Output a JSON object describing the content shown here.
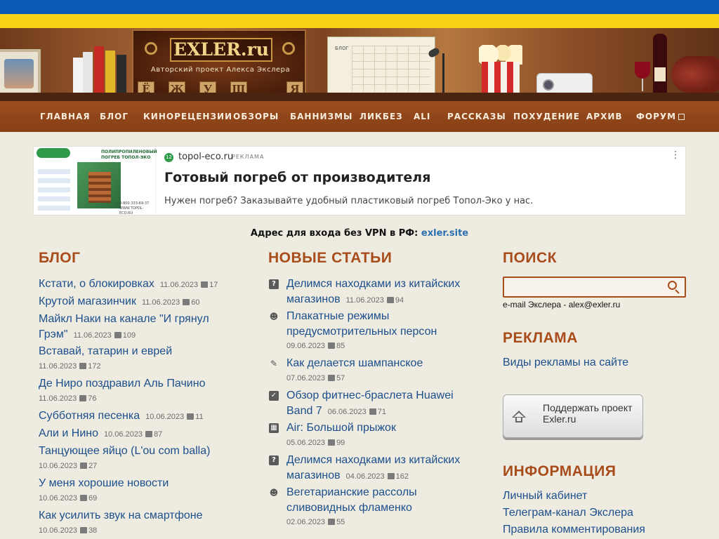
{
  "site": {
    "logo_text": "EXLER.ru",
    "logo_subtitle": "Авторский проект Алекса Экслера",
    "calendar_label": "БЛОГ",
    "banner_letters": [
      "Ё",
      "Ж",
      "У",
      "Щ",
      "Я"
    ]
  },
  "nav": {
    "items": [
      "ГЛАВНАЯ",
      "БЛОГ",
      "КИНОРЕЦЕНЗИИ",
      "ОБЗОРЫ",
      "БАННИЗМЫ",
      "ЛИКБЕЗ",
      "ALI",
      "РАССКАЗЫ",
      "ПОХУДЕНИЕ",
      "АРХИВ",
      "ФОРУМ"
    ]
  },
  "ad": {
    "source": "topol-eco.ru",
    "tag": "РЕКЛАМА",
    "title": "Готовый погреб от производителя",
    "description": "Нужен погреб? Заказывайте удобный пластиковый погреб Топол-Эко у нас.",
    "image_brand": "ТОПОЛ-ЭКО",
    "image_heading": "ПОЛИПРОПИЛЕНОВЫЙ ПОГРЕБ ТОПОЛ-ЭКО",
    "image_phone": "8-800-333-69-37",
    "image_site": "WWW.TOPOL-ECO.RU"
  },
  "vpn": {
    "text": "Адрес для входа без VPN в РФ:",
    "link": "exler.site"
  },
  "blog": {
    "title": "БЛОГ",
    "items": [
      {
        "title": "Кстати, о блокировках",
        "date": "11.06.2023",
        "comments": "17"
      },
      {
        "title": "Крутой магазинчик",
        "date": "11.06.2023",
        "comments": "60"
      },
      {
        "title": "Майкл Наки на канале \"И грянул",
        "title2": "Грэм\"",
        "date": "11.06.2023",
        "comments": "109"
      },
      {
        "title": "Вставай, татарин и еврей",
        "date": "11.06.2023",
        "comments": "172"
      },
      {
        "title": "Де Ниро поздравил Аль Пачино",
        "date": "11.06.2023",
        "comments": "76"
      },
      {
        "title": "Субботняя песенка",
        "date": "10.06.2023",
        "comments": "11"
      },
      {
        "title": "Али и Нино",
        "date": "10.06.2023",
        "comments": "87"
      },
      {
        "title": "Танцующее яйцо (L'ou com balla)",
        "date": "10.06.2023",
        "comments": "27"
      },
      {
        "title": "У меня хорошие новости",
        "date": "10.06.2023",
        "comments": "69"
      },
      {
        "title": "Как усилить звук на смартфоне",
        "date": "10.06.2023",
        "comments": "38"
      }
    ]
  },
  "articles": {
    "title": "НОВЫЕ СТАТЬИ",
    "items": [
      {
        "line1": "Делимся находками из китайских",
        "line2": "магазинов",
        "date": "11.06.2023",
        "comments": "94",
        "icon": "question-box-icon"
      },
      {
        "line1": "Плакатные режимы",
        "line2": "предусмотрительных персон",
        "date": "09.06.2023",
        "comments": "85",
        "icon": "smiley-icon"
      },
      {
        "line1": "Как делается шампанское",
        "line2": "",
        "date": "07.06.2023",
        "comments": "57",
        "icon": "pencil-icon"
      },
      {
        "line1": "Обзор фитнес-браслета Huawei",
        "line2": "Band 7",
        "date": "06.06.2023",
        "comments": "71",
        "icon": "clipboard-check-icon"
      },
      {
        "line1": "Air: Большой прыжок",
        "line2": "",
        "date": "05.06.2023",
        "comments": "99",
        "icon": "clapperboard-icon"
      },
      {
        "line1": "Делимся находками из китайских",
        "line2": "магазинов",
        "date": "04.06.2023",
        "comments": "162",
        "icon": "question-box-icon"
      },
      {
        "line1": "Вегетарианские рассолы",
        "line2": "сливовидных фламенко",
        "date": "02.06.2023",
        "comments": "55",
        "icon": "smiley-icon"
      }
    ]
  },
  "sidebar": {
    "search_title": "ПОИСК",
    "search_value": "",
    "email_note": "e-mail Экслера - alex@exler.ru",
    "ads_title": "РЕКЛАМА",
    "ads_link": "Виды рекламы на сайте",
    "support_label": "Поддержать проект Exler.ru",
    "info_title": "ИНФОРМАЦИЯ",
    "info_links": [
      "Личный кабинет",
      "Телеграм-канал Экслера",
      "Правила комментирования"
    ]
  },
  "colors": {
    "accent": "#a84c1a",
    "link": "#1c4f8c",
    "nav_bg": "#8f4519",
    "flag_blue": "#0a5bb5",
    "flag_yellow": "#f7d417",
    "page_bg": "#eeebe0"
  }
}
